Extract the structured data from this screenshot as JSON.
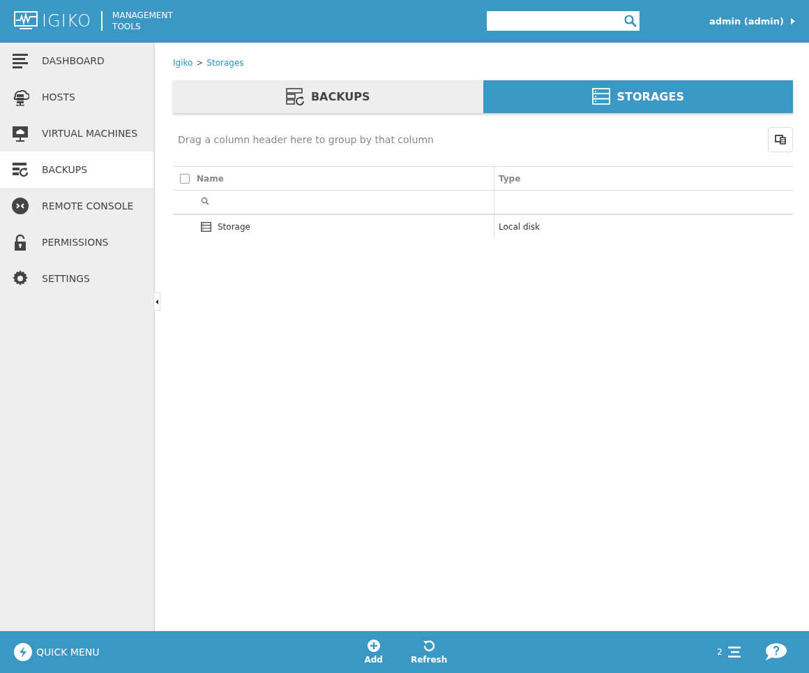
{
  "header": {
    "logo_name": "IGIKO",
    "logo_subtitle": [
      "MANAGEMENT",
      "TOOLS"
    ],
    "user": "admin (admin)"
  },
  "sidebar": {
    "items": [
      {
        "label": "DASHBOARD",
        "selected": false
      },
      {
        "label": "HOSTS",
        "selected": false
      },
      {
        "label": "VIRTUAL MACHINES",
        "selected": false
      },
      {
        "label": "BACKUPS",
        "selected": true
      },
      {
        "label": "REMOTE CONSOLE",
        "selected": false
      },
      {
        "label": "PERMISSIONS",
        "selected": false
      },
      {
        "label": "SETTINGS",
        "selected": false
      }
    ]
  },
  "breadcrumb": {
    "items": [
      "Igiko",
      "Storages"
    ],
    "separator": ">"
  },
  "tabs": [
    {
      "label": "BACKUPS",
      "selected": false
    },
    {
      "label": "STORAGES",
      "selected": true
    }
  ],
  "grid": {
    "group_hint": "Drag a column header here to group by that column",
    "select_all_checked": false,
    "columns": [
      "Name",
      "Type"
    ],
    "rows": [
      {
        "cells": [
          "Storage",
          "Local disk"
        ]
      }
    ]
  },
  "footer": {
    "quick_menu": "QUICK MENU",
    "actions": [
      "Add",
      "Refresh"
    ],
    "count": "2"
  }
}
